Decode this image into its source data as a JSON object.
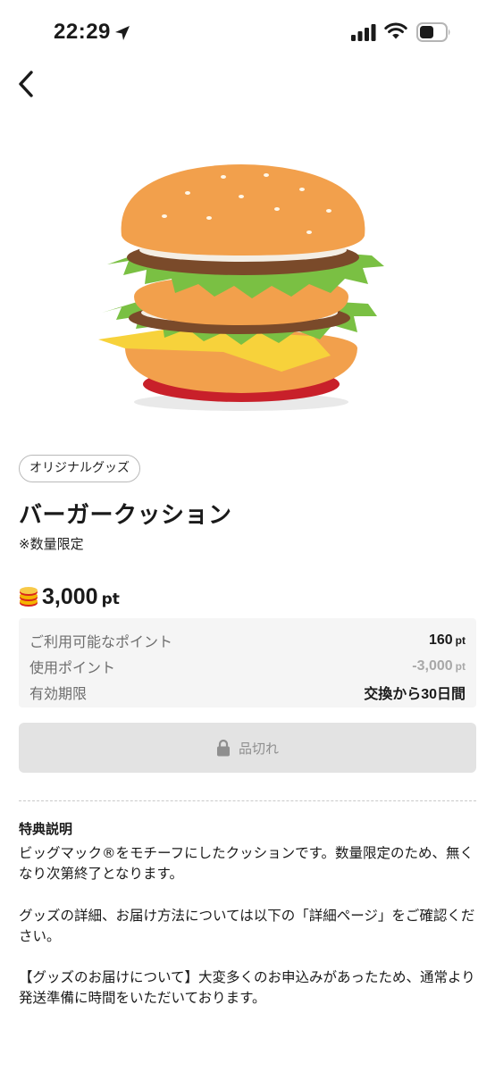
{
  "status_bar": {
    "time": "22:29"
  },
  "navigation": {
    "back_icon": "chevron-left-icon"
  },
  "product": {
    "image_icon": "burger-cushion-image",
    "category": "オリジナルグッズ",
    "title": "バーガークッション",
    "note": "※数量限定",
    "price": "3,000",
    "price_unit": "pt"
  },
  "points": {
    "rows": [
      {
        "label": "ご利用可能なポイント",
        "value": "160",
        "unit": "pt"
      },
      {
        "label": "使用ポイント",
        "value": "-3,000",
        "unit": "pt"
      },
      {
        "label": "有効期限",
        "value": "交換から30日間",
        "unit": ""
      }
    ]
  },
  "action": {
    "soldout_label": "品切れ"
  },
  "description": {
    "heading": "特典説明",
    "paragraph_1": "ビッグマック®をモチーフにしたクッションです。数量限定のため、無くなり次第終了となります。",
    "paragraph_2": "グッズの詳細、お届け方法については以下の「詳細ページ」をご確認ください。",
    "paragraph_3": "【グッズのお届けについて】大変多くのお申込みがあったため、通常より発送準備に時間をいただいております。"
  },
  "colors": {
    "soldout_bg": "#e3e3e3",
    "info_bg": "#f5f5f5",
    "muted_text": "#a8a8a8"
  }
}
